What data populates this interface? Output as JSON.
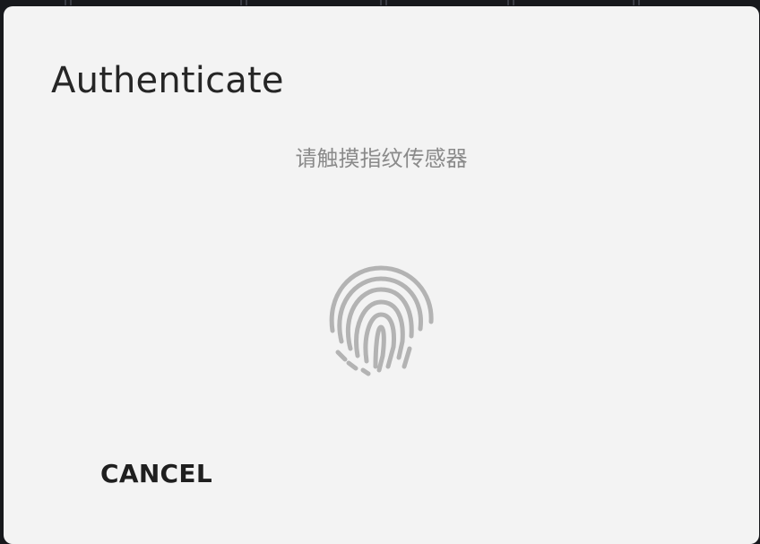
{
  "dialog": {
    "title": "Authenticate",
    "prompt": "请触摸指纹传感器",
    "icon": "fingerprint-icon",
    "cancel_label": "CANCEL"
  },
  "colors": {
    "dialog_background": "#f3f3f3",
    "backdrop": "#17181c",
    "title_text": "#262626",
    "prompt_text": "#8a8a8a",
    "icon_stroke": "#b3b3b3",
    "cancel_text": "#1f1f1f"
  }
}
